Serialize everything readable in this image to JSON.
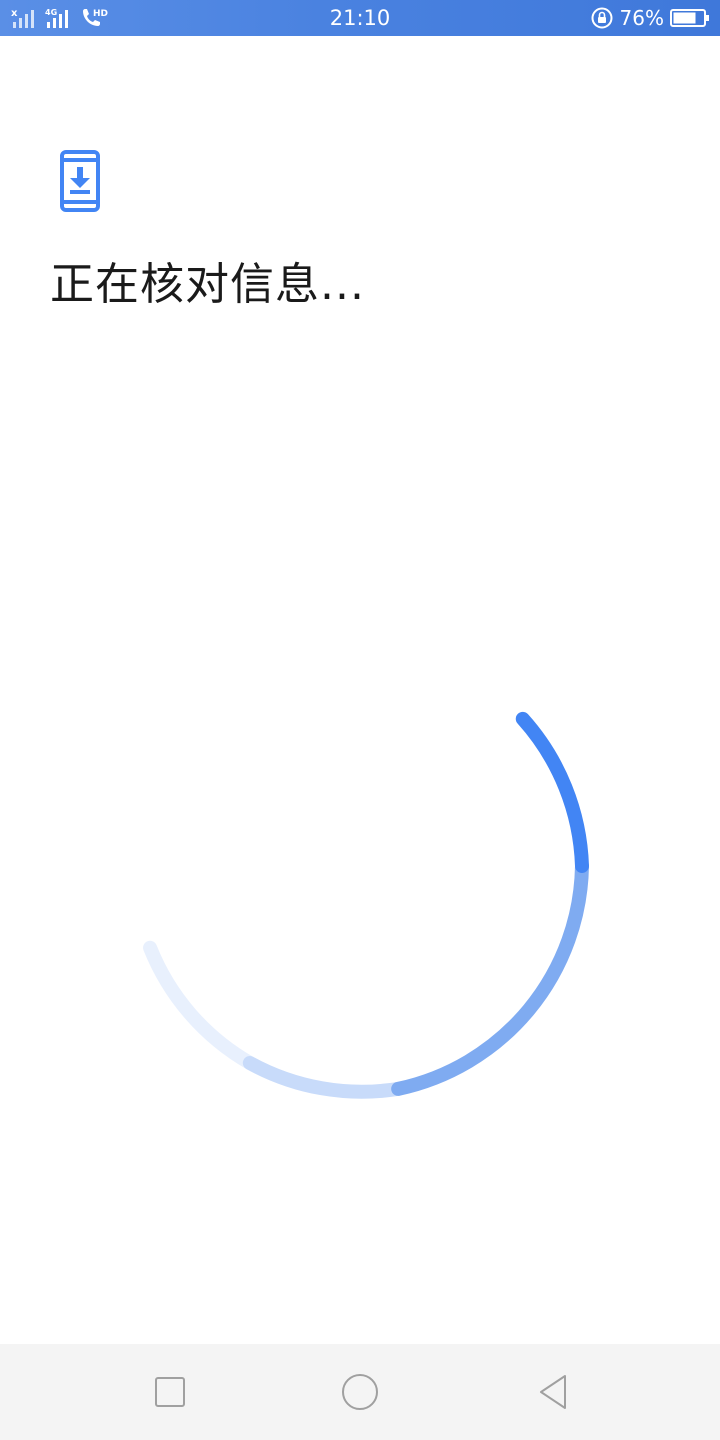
{
  "status_bar": {
    "time": "21:10",
    "battery_percent": "76%",
    "battery_level": 0.76,
    "network_label": "4G",
    "call_label": "HD",
    "icons": [
      "signal-x-icon",
      "signal-4g-icon",
      "volte-hd-icon",
      "rotation-lock-icon",
      "battery-icon"
    ]
  },
  "main": {
    "icon": "phone-download-icon",
    "title": "正在核对信息..."
  },
  "navigation": {
    "icons": [
      "recent-apps-icon",
      "home-icon",
      "back-icon"
    ]
  },
  "colors": {
    "accent": "#4285f4",
    "status_bar": "#4a82e0",
    "nav_bar": "#f4f4f4"
  }
}
